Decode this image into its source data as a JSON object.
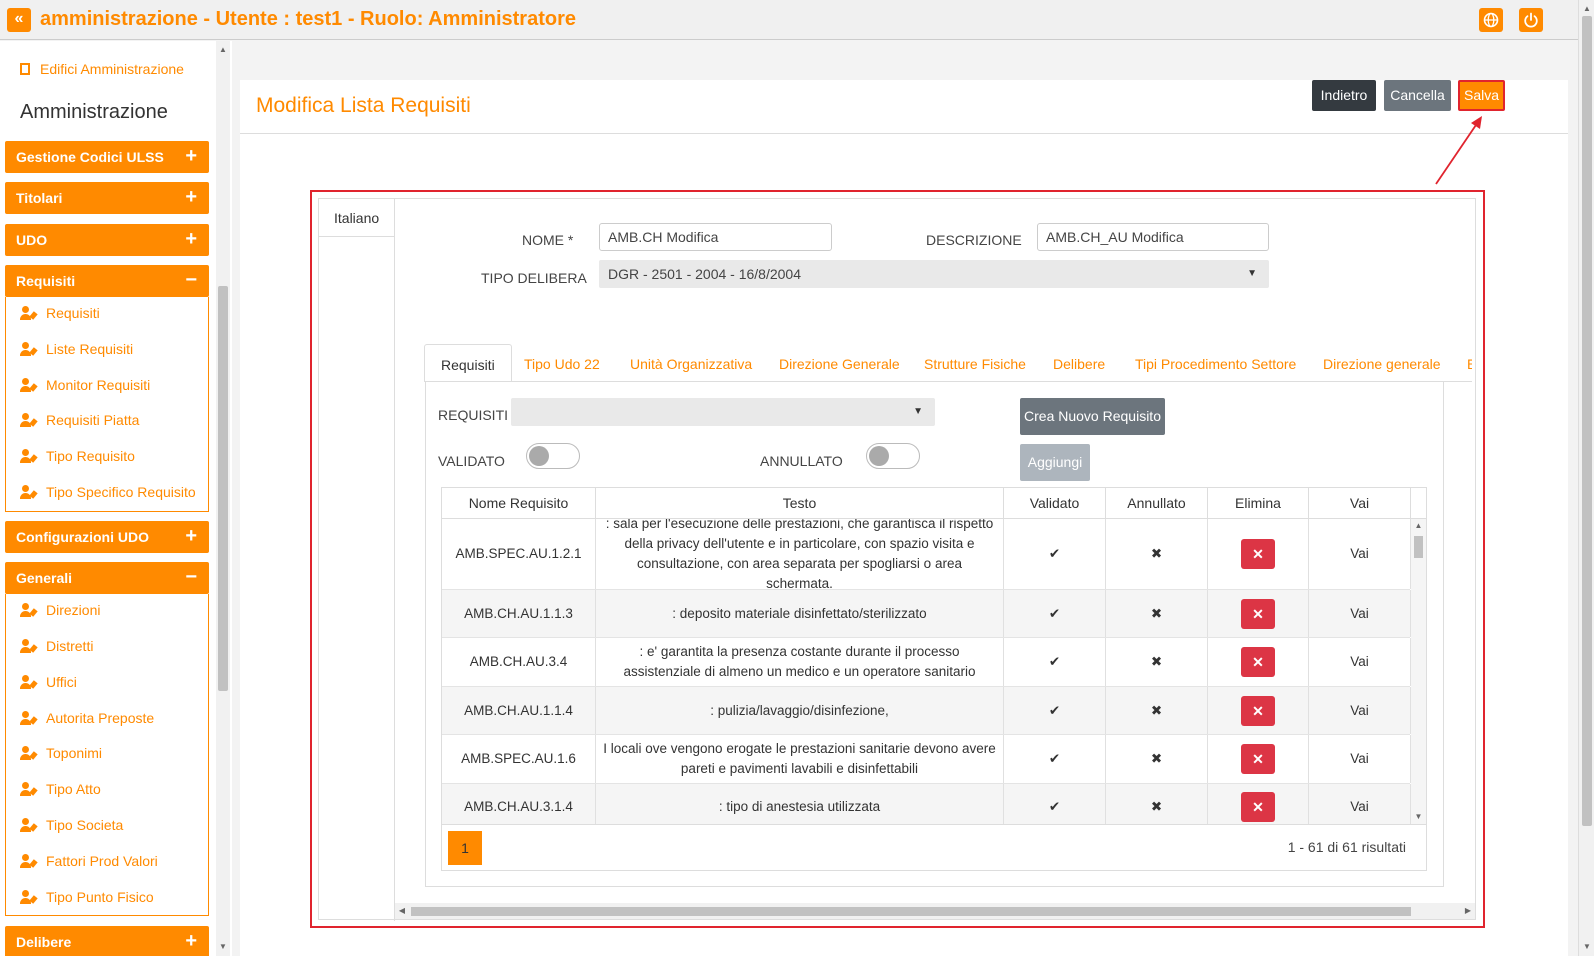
{
  "app": {
    "title": "amministrazione - Utente : test1 - Ruolo: Amministratore",
    "collapse_glyph": "«",
    "accent_color": "#ff8a00"
  },
  "sidebar": {
    "top_link": "Edifici Amministrazione",
    "heading": "Amministrazione",
    "sections": [
      {
        "label": "Gestione Codici ULSS",
        "sign": "+"
      },
      {
        "label": "Titolari",
        "sign": "+"
      },
      {
        "label": "UDO",
        "sign": "+"
      },
      {
        "label": "Requisiti",
        "sign": "−",
        "items": [
          "Requisiti",
          "Liste Requisiti",
          "Monitor Requisiti",
          "Requisiti Piatta",
          "Tipo Requisito",
          "Tipo Specifico Requisito"
        ]
      },
      {
        "label": "Configurazioni UDO",
        "sign": "+"
      },
      {
        "label": "Generali",
        "sign": "−",
        "items": [
          "Direzioni",
          "Distretti",
          "Uffici",
          "Autorita Preposte",
          "Toponimi",
          "Tipo Atto",
          "Tipo Societa",
          "Fattori Prod Valori",
          "Tipo Punto Fisico"
        ]
      },
      {
        "label": "Delibere",
        "sign": "+"
      }
    ]
  },
  "header": {
    "title": "Modifica Lista Requisiti",
    "back_label": "Indietro",
    "cancel_label": "Cancella",
    "save_label": "Salva"
  },
  "form": {
    "lang_tab": "Italiano",
    "nome_label": "NOME *",
    "nome_value": "AMB.CH Modifica",
    "descrizione_label": "DESCRIZIONE",
    "descrizione_value": "AMB.CH_AU Modifica",
    "tipo_delibera_label": "TIPO DELIBERA",
    "tipo_delibera_value": "DGR - 2501 - 2004 - 16/8/2004"
  },
  "tabs": [
    "Requisiti",
    "Tipo Udo 22",
    "Unità Organizzativa",
    "Direzione Generale",
    "Strutture Fisiche",
    "Delibere",
    "Tipi Procedimento Settore",
    "Direzione generale",
    "E"
  ],
  "requisiti_tab": {
    "requisiti_label": "REQUISITI",
    "requisiti_value": "",
    "validato_label": "VALIDATO",
    "annullato_label": "ANNULLATO",
    "create_label": "Crea Nuovo Requisito",
    "add_label": "Aggiungi"
  },
  "grid": {
    "columns": [
      "Nome Requisito",
      "Testo",
      "Validato",
      "Annullato",
      "Elimina",
      "Vai"
    ],
    "rows": [
      {
        "nome": "AMB.SPEC.AU.1.2.1",
        "testo": ": sala per l'esecuzione delle prestazioni, che garantisca il rispetto della privacy dell'utente e in particolare, con spazio visita e consultazione, con area separata per spogliarsi o area schermata.",
        "validato": "✔",
        "annullato": "✖",
        "elimina": "✕",
        "vai": "Vai"
      },
      {
        "nome": "AMB.CH.AU.1.1.3",
        "testo": ": deposito materiale disinfettato/sterilizzato",
        "validato": "✔",
        "annullato": "✖",
        "elimina": "✕",
        "vai": "Vai"
      },
      {
        "nome": "AMB.CH.AU.3.4",
        "testo": ": e' garantita la presenza costante durante il processo assistenziale di almeno un medico e un operatore sanitario",
        "validato": "✔",
        "annullato": "✖",
        "elimina": "✕",
        "vai": "Vai"
      },
      {
        "nome": "AMB.CH.AU.1.1.4",
        "testo": ": pulizia/lavaggio/disinfezione,",
        "validato": "✔",
        "annullato": "✖",
        "elimina": "✕",
        "vai": "Vai"
      },
      {
        "nome": "AMB.SPEC.AU.1.6",
        "testo": "I locali ove vengono erogate le prestazioni sanitarie devono avere pareti e pavimenti lavabili e disinfettabili",
        "validato": "✔",
        "annullato": "✖",
        "elimina": "✕",
        "vai": "Vai"
      },
      {
        "nome": "AMB.CH.AU.3.1.4",
        "testo": ": tipo di anestesia utilizzata",
        "validato": "✔",
        "annullato": "✖",
        "elimina": "✕",
        "vai": "Vai"
      }
    ],
    "page": "1",
    "result_info": "1 - 61 di 61 risultati"
  }
}
